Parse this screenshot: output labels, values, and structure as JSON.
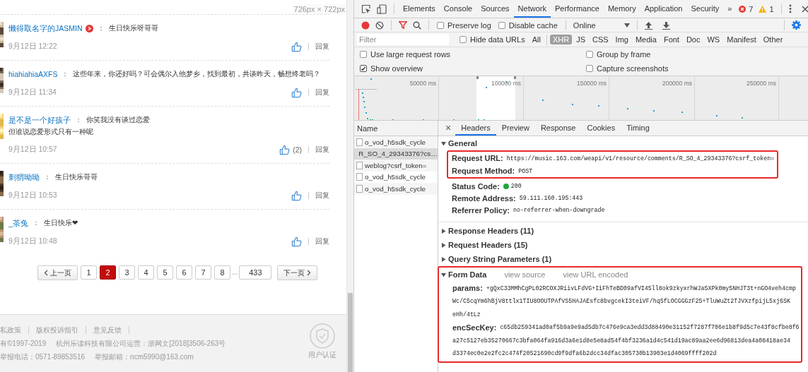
{
  "page": {
    "size_badge": "726px × 722px",
    "comments": [
      {
        "user": "懒得取名字的JASMIN",
        "vip": true,
        "colon": "：",
        "lines": [
          "生日快乐呀哥哥"
        ],
        "date": "9月12日 12:22",
        "reply": "回复"
      },
      {
        "user": "hiahiahiaAXFS",
        "vip": false,
        "colon": "：",
        "lines": [
          "这些年来，你还好吗？可会偶尔入他梦乡，找到最初，共谈昨天，畅想终老吗？"
        ],
        "date": "9月12日 11:34",
        "reply": "回复"
      },
      {
        "user": "是不是一个好孩子",
        "vip": false,
        "colon": "：",
        "lines": [
          "你笑我没有谈过恋爱",
          "但谁说恋爱形式只有一种呢"
        ],
        "date": "9月12日 10:57",
        "likes": "(2)",
        "reply": "回复"
      },
      {
        "user": "刺猬呦呦",
        "vip": false,
        "colon": "：",
        "lines": [
          "生日快乐哥哥"
        ],
        "date": "9月12日 10:53",
        "reply": "回复"
      },
      {
        "user": "_茶兔",
        "vip": false,
        "colon": "：",
        "lines": [
          "生日快乐❤"
        ],
        "date": "9月12日 10:48",
        "reply": "回复"
      }
    ],
    "pagination": {
      "prev": "上一页",
      "pages": [
        {
          "label": "1",
          "selected": false
        },
        {
          "label": "2",
          "selected": true
        },
        {
          "label": "3",
          "selected": false
        },
        {
          "label": "4",
          "selected": false
        },
        {
          "label": "5",
          "selected": false
        },
        {
          "label": "6",
          "selected": false
        },
        {
          "label": "7",
          "selected": false
        },
        {
          "label": "8",
          "selected": false
        }
      ],
      "ellipsis": "...",
      "last_page": {
        "label": "433",
        "selected": false
      },
      "next": "下一页"
    },
    "footer": {
      "links": [
        "私政策",
        "版权投诉指引",
        "意见反馈"
      ],
      "lines": [
        [
          "有©1997-2019",
          "杭州乐读科技有限公司运营：浙网文[2018]3506-263号"
        ],
        [
          "举报电话：0571-89853516",
          "举报邮箱：ncm5990@163.com"
        ]
      ],
      "badge_label": "用户认证"
    }
  },
  "devtools": {
    "tabs": [
      {
        "label": "Elements",
        "selected": false
      },
      {
        "label": "Console",
        "selected": false
      },
      {
        "label": "Sources",
        "selected": false
      },
      {
        "label": "Network",
        "selected": true
      },
      {
        "label": "Performance",
        "selected": false
      },
      {
        "label": "Memory",
        "selected": false
      },
      {
        "label": "Application",
        "selected": false
      },
      {
        "label": "Security",
        "selected": false
      }
    ],
    "more": "»",
    "errors": "7",
    "warnings": "1",
    "toolbar": {
      "recording": true,
      "filter_active": true,
      "preserve_log": {
        "label": "Preserve log",
        "checked": false
      },
      "disable_cache": {
        "label": "Disable cache",
        "checked": false
      },
      "throttling": "Online"
    },
    "filter_bar": {
      "placeholder": "Filter",
      "hide_data_urls": {
        "label": "Hide data URLs",
        "checked": false
      },
      "types": [
        {
          "label": "All",
          "selected": false
        },
        {
          "label": "XHR",
          "selected": true
        },
        {
          "label": "JS",
          "selected": false
        },
        {
          "label": "CSS",
          "selected": false
        },
        {
          "label": "Img",
          "selected": false
        },
        {
          "label": "Media",
          "selected": false
        },
        {
          "label": "Font",
          "selected": false
        },
        {
          "label": "Doc",
          "selected": false
        },
        {
          "label": "WS",
          "selected": false
        },
        {
          "label": "Manifest",
          "selected": false
        },
        {
          "label": "Other",
          "selected": false
        }
      ]
    },
    "options": [
      {
        "label": "Use large request rows",
        "checked": false
      },
      {
        "label": "Group by frame",
        "checked": false
      },
      {
        "label": "Show overview",
        "checked": true
      },
      {
        "label": "Capture screenshots",
        "checked": false
      }
    ],
    "overview": {
      "ticks": [
        "50000 ms",
        "100000 ms",
        "150000 ms",
        "200000 ms",
        "250000 ms"
      ]
    },
    "requests": {
      "header": "Name",
      "items": [
        {
          "name": "o_vod_h5sdk_cycle",
          "selected": false
        },
        {
          "name": "R_SO_4_29343376?cs…",
          "selected": true
        },
        {
          "name": "weblog?csrf_token=",
          "selected": false
        },
        {
          "name": "o_vod_h5sdk_cycle",
          "selected": false
        },
        {
          "name": "o_vod_h5sdk_cycle",
          "selected": false
        }
      ]
    },
    "detail": {
      "close": "×",
      "tabs": [
        {
          "label": "Headers",
          "selected": true
        },
        {
          "label": "Preview",
          "selected": false
        },
        {
          "label": "Response",
          "selected": false
        },
        {
          "label": "Cookies",
          "selected": false
        },
        {
          "label": "Timing",
          "selected": false
        }
      ],
      "general": {
        "title": "General",
        "expanded": true,
        "groups": [
          {
            "highlighted": true,
            "rows": [
              {
                "label": "Request URL:",
                "value": "https://music.163.com/weapi/v1/resource/comments/R_SO_4_29343376?csrf_token="
              },
              {
                "label": "Request Method:",
                "value": "POST"
              }
            ]
          },
          {
            "highlighted": false,
            "rows": [
              {
                "label": "Status Code:",
                "value": "200",
                "color": "#1fa83a"
              },
              {
                "label": "Remote Address:",
                "value": "59.111.160.195:443"
              },
              {
                "label": "Referrer Policy:",
                "value": "no-referrer-when-downgrade"
              }
            ]
          }
        ]
      },
      "sections": [
        {
          "title": "Response Headers (11)",
          "expanded": false
        },
        {
          "title": "Request Headers (15)",
          "expanded": false
        },
        {
          "title": "Query String Parameters (1)",
          "expanded": false
        }
      ],
      "form_data": {
        "title": "Form Data",
        "expanded": true,
        "highlighted": true,
        "links": [
          "view source",
          "view URL encoded"
        ],
        "fields": [
          {
            "label": "params:",
            "lines": [
              "+gQxC33MMhCgPL02RCOXJRiivLFdVG+IiFhTeBD09afVI45ll8ok9zkyxrhWJa5XPk0my5NHJT3t+nGO4veh4cmp",
              "Wc/C5cqYm6hBjV8ttlx1TIU8OOUTPAfVS5HAJAEsfc8bvgcekI3teiVF/hq5fLOCGGGzF25+TluWuZt2TJVXzfpijL5xj6SK",
              "eHh/4tLz"
            ]
          },
          {
            "label": "encSecKey:",
            "lines": [
              "c65db259341ad0af5b9a9e9ad5db7c476e9ca3edd3d88490e31152f7287f706e1b8f9d5c7e43f8cfbe8f6",
              "a27c5127eb35270667c3bfa064fa916d3a6e1d8e5e8ad54f4bf3236a1d4c541d19ac89aa2ee6d96813dea4a08418ae34",
              "d3374ec0e2e2fc2c474f20521690cd9f9dfa6b2dcc34dfac305730b13903e1d4069ffff202d"
            ]
          }
        ]
      }
    }
  }
}
